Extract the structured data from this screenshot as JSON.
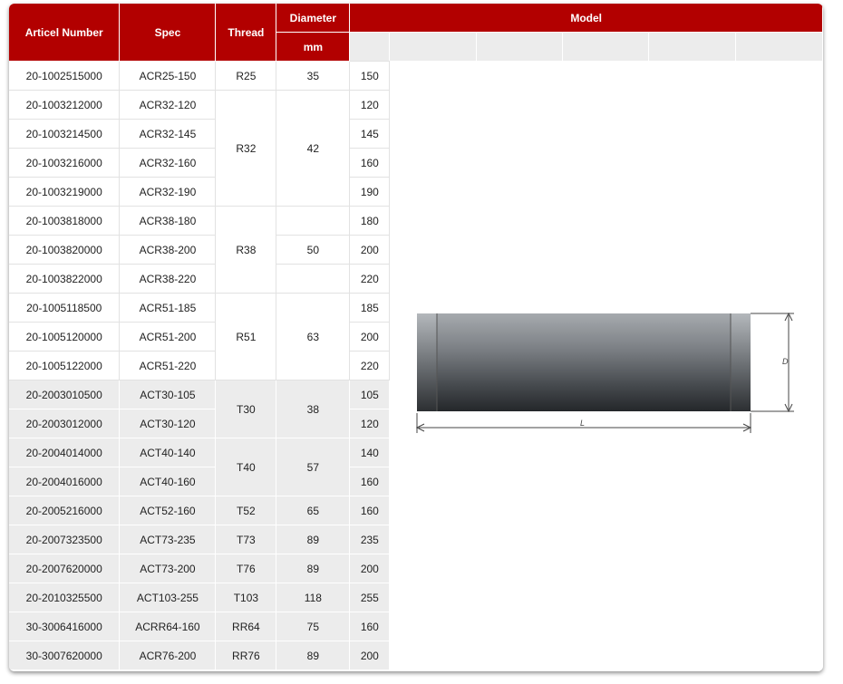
{
  "headers": {
    "article_number": "Articel Number",
    "spec": "Spec",
    "thread": "Thread",
    "diameter": "Diameter",
    "diameter_unit": "mm",
    "model": "Model"
  },
  "rows": [
    {
      "article": "20-1002515000",
      "spec": "ACR25-150",
      "model": "150"
    },
    {
      "article": "20-1003212000",
      "spec": "ACR32-120",
      "model": "120"
    },
    {
      "article": "20-1003214500",
      "spec": "ACR32-145",
      "model": "145"
    },
    {
      "article": "20-1003216000",
      "spec": "ACR32-160",
      "model": "160"
    },
    {
      "article": "20-1003219000",
      "spec": "ACR32-190",
      "model": "190"
    },
    {
      "article": "20-1003818000",
      "spec": "ACR38-180",
      "model": "180"
    },
    {
      "article": "20-1003820000",
      "spec": "ACR38-200",
      "model": "200"
    },
    {
      "article": "20-1003822000",
      "spec": "ACR38-220",
      "model": "220"
    },
    {
      "article": "20-1005118500",
      "spec": "ACR51-185",
      "model": "185"
    },
    {
      "article": "20-1005120000",
      "spec": "ACR51-200",
      "model": "200"
    },
    {
      "article": "20-1005122000",
      "spec": "ACR51-220",
      "model": "220"
    },
    {
      "article": "20-2003010500",
      "spec": "ACT30-105",
      "model": "105"
    },
    {
      "article": "20-2003012000",
      "spec": "ACT30-120",
      "model": "120"
    },
    {
      "article": "20-2004014000",
      "spec": "ACT40-140",
      "model": "140"
    },
    {
      "article": "20-2004016000",
      "spec": "ACT40-160",
      "model": "160"
    },
    {
      "article": "20-2005216000",
      "spec": "ACT52-160",
      "model": "160"
    },
    {
      "article": "20-2007323500",
      "spec": "ACT73-235",
      "model": "235"
    },
    {
      "article": "20-2007620000",
      "spec": "ACT73-200",
      "model": "200"
    },
    {
      "article": "20-2010325500",
      "spec": "ACT103-255",
      "model": "255"
    },
    {
      "article": "30-3006416000",
      "spec": "ACRR64-160",
      "model": "160"
    },
    {
      "article": "30-3007620000",
      "spec": "ACR76-200",
      "model": "200"
    }
  ],
  "groups": [
    {
      "thread": "R25",
      "diameter": "35"
    },
    {
      "thread": "R32",
      "diameter": "42"
    },
    {
      "thread": "R38",
      "diameter": "50"
    },
    {
      "thread": "R51",
      "diameter": "63"
    },
    {
      "thread": "T30",
      "diameter": "38"
    },
    {
      "thread": "T40",
      "diameter": "57"
    },
    {
      "thread": "T52",
      "diameter": "65"
    },
    {
      "thread": "T73",
      "diameter": "89"
    },
    {
      "thread": "T76",
      "diameter": "89"
    },
    {
      "thread": "T103",
      "diameter": "118"
    },
    {
      "thread": "RR64",
      "diameter": "75"
    },
    {
      "thread": "RR76",
      "diameter": "89"
    }
  ],
  "drawing": {
    "length_label": "L",
    "diameter_label": "D",
    "colors": {
      "body_top": "#9a9ea3",
      "body_bottom": "#2c2f33",
      "header_red": "#b20000"
    }
  }
}
